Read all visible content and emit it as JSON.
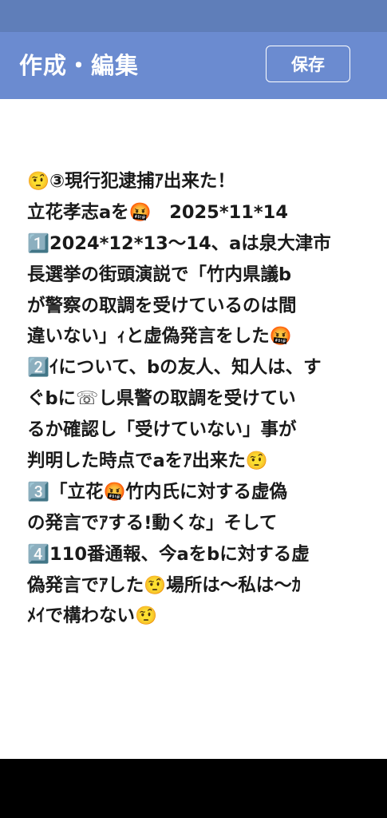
{
  "header": {
    "title": "作成・編集",
    "save_label": "保存"
  },
  "memo": {
    "lines": [
      "🤨③現行犯逮捕ｱ出来た！",
      "立花孝志aを🤬　2025*11*14",
      "1️⃣2024*12*13～14、aは泉大津市",
      "長選挙の街頭演説で「竹内県議b",
      "が警察の取調を受けているのは間",
      "違いない」ｨと虚偽発言をした🤬",
      "2️⃣ｲについて、bの友人、知人は、す",
      "ぐbに☏し県警の取調を受けてい",
      "るか確認し「受けていない」事が",
      "判明した時点でaをｱ出来た🤨",
      "3️⃣「立花🤬竹内氏に対する虚偽",
      "の発言でｱする!動くな」そして",
      "4️⃣110番通報、今aをbに対する虚",
      "偽発言でｱした🤨場所は～私は～ｶ",
      "ﾒｲで構わない🤨"
    ]
  },
  "colors": {
    "status_bar": "#5f7eb9",
    "header": "#6b8bd0",
    "text": "#1a1a1a",
    "navigation_bar": "#000000"
  }
}
